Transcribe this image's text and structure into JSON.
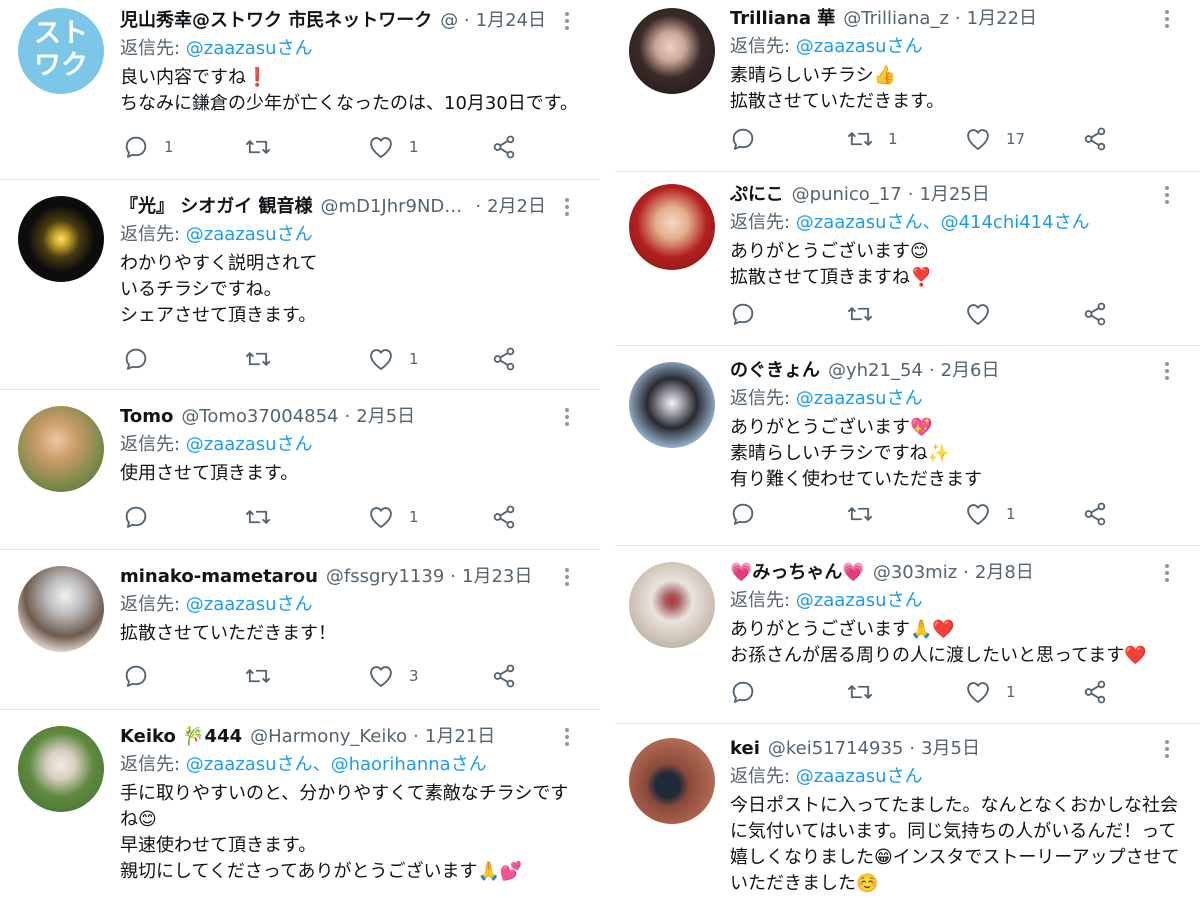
{
  "colors": {
    "accent": "#1d9bf0",
    "muted": "#536471",
    "text": "#0f1419",
    "divider": "#e6e9ec"
  },
  "left_tweets": [
    {
      "name": "児山秀幸@ストワク 市民ネットワーク",
      "handle": "@...",
      "date": "1月24日",
      "reply_prefix": "返信先: ",
      "reply_mentions": "@zaazasuさん",
      "lines": [
        "良い内容ですね❗",
        "ちなみに鎌倉の少年が亡くなったのは、10月30日です。"
      ],
      "replies": "1",
      "retweets": "",
      "likes": "1",
      "avatar_text": "ストワク"
    },
    {
      "name": "『光』 シオガイ 観音様",
      "handle": "@mD1Jhr9NDz0T...",
      "date": "2月2日",
      "reply_prefix": "返信先: ",
      "reply_mentions": "@zaazasuさん",
      "lines": [
        "わかりやすく説明されて",
        "いるチラシですね。",
        "シェアさせて頂きます。"
      ],
      "replies": "",
      "retweets": "",
      "likes": "1"
    },
    {
      "name": "Tomo",
      "handle": "@Tomo37004854",
      "date": "2月5日",
      "reply_prefix": "返信先: ",
      "reply_mentions": "@zaazasuさん",
      "lines": [
        "使用させて頂きます。"
      ],
      "replies": "",
      "retweets": "",
      "likes": "1"
    },
    {
      "name": "minako-mametarou",
      "handle": "@fssgry1139",
      "date": "1月23日",
      "reply_prefix": "返信先: ",
      "reply_mentions": "@zaazasuさん",
      "lines": [
        "拡散させていただきます！"
      ],
      "replies": "",
      "retweets": "",
      "likes": "3"
    },
    {
      "name": "Keiko 🎋444",
      "handle": "@Harmony_Keiko",
      "date": "1月21日",
      "reply_prefix": "返信先: ",
      "reply_mentions": "@zaazasuさん、@haorihannaさん",
      "lines": [
        "手に取りやすいのと、分かりやすくて素敵なチラシです",
        "ね😊",
        "早速使わせて頂きます。",
        "親切にしてくださってありがとうございます🙏💕"
      ],
      "replies": "",
      "retweets": "",
      "likes": ""
    }
  ],
  "right_tweets": [
    {
      "name": "Trilliana 華",
      "handle": "@Trilliana_z",
      "date": "1月22日",
      "reply_prefix": "返信先: ",
      "reply_mentions": "@zaazasuさん",
      "lines": [
        "素晴らしいチラシ👍",
        "拡散させていただきます。"
      ],
      "replies": "",
      "retweets": "1",
      "likes": "17"
    },
    {
      "name": "ぷにこ",
      "handle": "@punico_17",
      "date": "1月25日",
      "reply_prefix": "返信先: ",
      "reply_mentions": "@zaazasuさん、@414chi414さん",
      "lines": [
        "ありがとうございます😊",
        "拡散させて頂きますね❣️"
      ],
      "replies": "",
      "retweets": "",
      "likes": ""
    },
    {
      "name": "のぐきょん",
      "handle": "@yh21_54",
      "date": "2月6日",
      "reply_prefix": "返信先: ",
      "reply_mentions": "@zaazasuさん",
      "lines": [
        "ありがとうございます💖",
        "素晴らしいチラシですね✨",
        "有り難く使わせていただきます"
      ],
      "replies": "",
      "retweets": "",
      "likes": "1"
    },
    {
      "name": "💗みっちゃん💗",
      "handle": "@303miz",
      "date": "2月8日",
      "reply_prefix": "返信先: ",
      "reply_mentions": "@zaazasuさん",
      "lines": [
        "ありがとうございます🙏❤️",
        "お孫さんが居る周りの人に渡したいと思ってます❤️"
      ],
      "replies": "",
      "retweets": "",
      "likes": "1"
    },
    {
      "name": "kei",
      "handle": "@kei51714935",
      "date": "3月5日",
      "reply_prefix": "返信先: ",
      "reply_mentions": "@zaazasuさん",
      "lines": [
        "今日ポストに入ってたました。なんとなくおかしな社会",
        "に気付いてはいます。同じ気持ちの人がいるんだ！って",
        "嬉しくなりました😁インスタでストーリーアップさせて",
        "いただきました☺️"
      ],
      "replies": "",
      "retweets": "",
      "likes": ""
    }
  ]
}
